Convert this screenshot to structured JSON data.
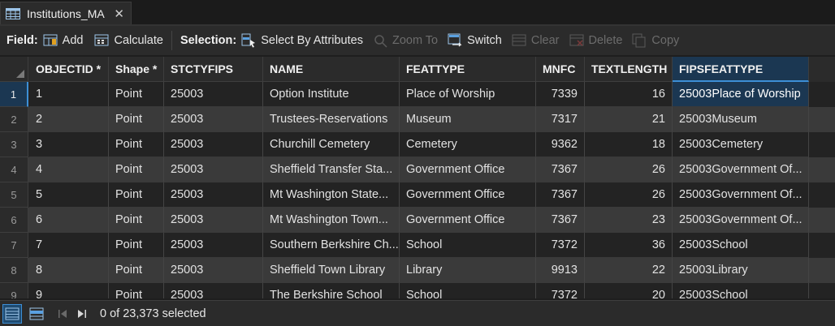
{
  "tab": {
    "title": "Institutions_MA",
    "close_glyph": "✕",
    "icon": "table-icon"
  },
  "toolbar": {
    "field_label": "Field:",
    "add_label": "Add",
    "calculate_label": "Calculate",
    "selection_label": "Selection:",
    "select_by_attributes_label": "Select By Attributes",
    "zoom_to_label": "Zoom To",
    "switch_label": "Switch",
    "clear_label": "Clear",
    "delete_label": "Delete",
    "copy_label": "Copy"
  },
  "table": {
    "columns": [
      "OBJECTID *",
      "Shape *",
      "STCTYFIPS",
      "NAME",
      "FEATTYPE",
      "MNFC",
      "TEXTLENGTH",
      "FIPSFEATTYPE"
    ],
    "rows": [
      {
        "num": "1",
        "cells": [
          "1",
          "Point",
          "25003",
          "Option Institute",
          "Place of Worship",
          "7339",
          "16",
          "25003Place of Worship"
        ]
      },
      {
        "num": "2",
        "cells": [
          "2",
          "Point",
          "25003",
          "Trustees-Reservations",
          "Museum",
          "7317",
          "21",
          "25003Museum"
        ]
      },
      {
        "num": "3",
        "cells": [
          "3",
          "Point",
          "25003",
          "Churchill Cemetery",
          "Cemetery",
          "9362",
          "18",
          "25003Cemetery"
        ]
      },
      {
        "num": "4",
        "cells": [
          "4",
          "Point",
          "25003",
          "Sheffield Transfer Sta...",
          "Government Office",
          "7367",
          "26",
          "25003Government Of..."
        ]
      },
      {
        "num": "5",
        "cells": [
          "5",
          "Point",
          "25003",
          "Mt Washington State...",
          "Government Office",
          "7367",
          "26",
          "25003Government Of..."
        ]
      },
      {
        "num": "6",
        "cells": [
          "6",
          "Point",
          "25003",
          "Mt Washington Town...",
          "Government Office",
          "7367",
          "23",
          "25003Government Of..."
        ]
      },
      {
        "num": "7",
        "cells": [
          "7",
          "Point",
          "25003",
          "Southern Berkshire Ch...",
          "School",
          "7372",
          "36",
          "25003School"
        ]
      },
      {
        "num": "8",
        "cells": [
          "8",
          "Point",
          "25003",
          "Sheffield Town Library",
          "Library",
          "9913",
          "22",
          "25003Library"
        ]
      },
      {
        "num": "9",
        "cells": [
          "9",
          "Point",
          "25003",
          "The Berkshire School",
          "School",
          "7372",
          "20",
          "25003School"
        ]
      }
    ]
  },
  "status": {
    "selected_text": "0 of 23,373 selected"
  },
  "colors": {
    "accent": "#3d8fd6",
    "selected_bg": "#1b3752",
    "background": "#1e1e1e",
    "toolbar": "#2b2b2b"
  }
}
